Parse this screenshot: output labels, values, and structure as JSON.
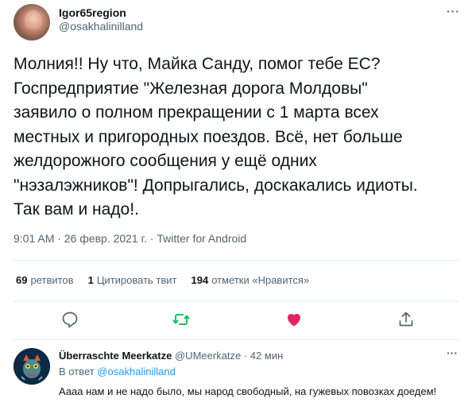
{
  "tweet": {
    "author_name": "Igor65region",
    "author_handle": "@osakhalinilland",
    "text": "Молния!! Ну что, Майка Санду, помог тебе ЕС?\nГоспредприятие \"Железная дорога Молдовы\"\nзаявило о полном прекращении с 1 марта всех\nместных и пригородных поездов. Всё, нет больше\nжелдорожного сообщения у ещё одних\n\"нэзалэжников\"! Допрыгались, доскакались идиоты.\nТак вам и надо!.",
    "meta": "9:01 AM · 26 февр. 2021 г. · Twitter for Android",
    "more_icon": "···"
  },
  "stats": {
    "retweets_count": "69",
    "retweets_label": "ретвитов",
    "quotes_count": "1",
    "quotes_label": "Цитировать твит",
    "likes_count": "194",
    "likes_label": "отметки «Нравится»"
  },
  "actions": {
    "reply_icon": "reply-icon",
    "retweet_icon": "retweet-icon",
    "like_icon": "heart-icon",
    "share_icon": "share-icon",
    "retweet_color": "#17bf63",
    "like_color": "#e0245e"
  },
  "reply": {
    "author_name": "Überraschte Meerkatze",
    "author_handle": "@UMeerkatze · 42 мин",
    "reply_to_label": "В ответ",
    "reply_to_handle": "@osakhalinilland",
    "text": "Аааа нам и не надо было, мы народ свободный, на гужевых повозках доедем!",
    "more_icon": "···"
  }
}
